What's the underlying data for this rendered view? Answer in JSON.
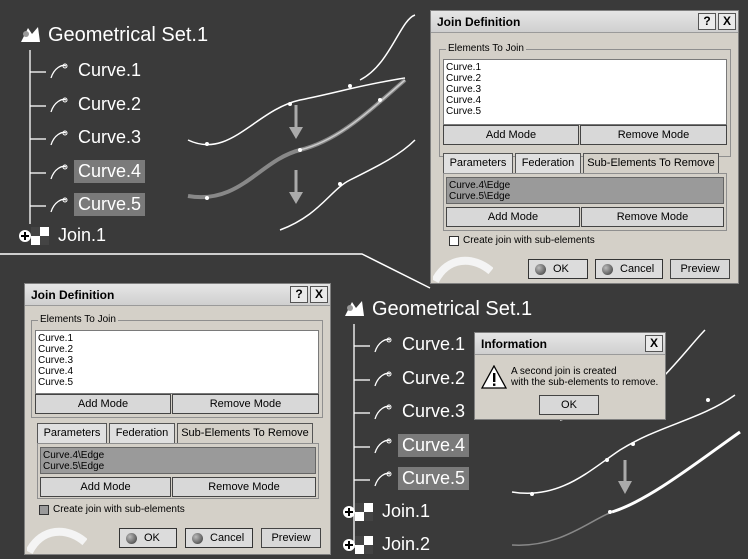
{
  "colors": {
    "background": "#3a3a3a",
    "dialog": "#d4d0c8",
    "selected_row": "#9a9a9a",
    "curve": "#ffffff",
    "join_curve": "#888888"
  },
  "tree_top": {
    "root": "Geometrical Set.1",
    "curves": [
      "Curve.1",
      "Curve.2",
      "Curve.3",
      "Curve.4",
      "Curve.5"
    ],
    "joins": [
      "Join.1"
    ]
  },
  "tree_bottom": {
    "root": "Geometrical Set.1",
    "curves": [
      "Curve.1",
      "Curve.2",
      "Curve.3",
      "Curve.4",
      "Curve.5"
    ],
    "joins": [
      "Join.1",
      "Join.2"
    ]
  },
  "dialog_top": {
    "title": "Join Definition",
    "help": "?",
    "close": "X",
    "elements_group": "Elements To Join",
    "elements": [
      "Curve.1",
      "Curve.2",
      "Curve.3",
      "Curve.4",
      "Curve.5"
    ],
    "add_mode": "Add Mode",
    "remove_mode": "Remove Mode",
    "tabs": [
      "Parameters",
      "Federation",
      "Sub-Elements To Remove"
    ],
    "sub_elements": [
      "Curve.4\\Edge",
      "Curve.5\\Edge"
    ],
    "sub_add_mode": "Add Mode",
    "sub_remove_mode": "Remove Mode",
    "checkbox_label": "Create join with sub-elements",
    "ok": "OK",
    "cancel": "Cancel",
    "preview": "Preview"
  },
  "dialog_bottom": {
    "title": "Join Definition",
    "help": "?",
    "close": "X",
    "elements_group": "Elements To Join",
    "elements": [
      "Curve.1",
      "Curve.2",
      "Curve.3",
      "Curve.4",
      "Curve.5"
    ],
    "add_mode": "Add Mode",
    "remove_mode": "Remove Mode",
    "tabs": [
      "Parameters",
      "Federation",
      "Sub-Elements To Remove"
    ],
    "sub_elements": [
      "Curve.4\\Edge",
      "Curve.5\\Edge"
    ],
    "sub_add_mode": "Add Mode",
    "sub_remove_mode": "Remove Mode",
    "checkbox_label": "Create join with sub-elements",
    "ok": "OK",
    "cancel": "Cancel",
    "preview": "Preview"
  },
  "info_dialog": {
    "title": "Information",
    "close": "X",
    "message_line1": "A second join is created",
    "message_line2": "with the sub-elements to remove.",
    "ok": "OK"
  }
}
